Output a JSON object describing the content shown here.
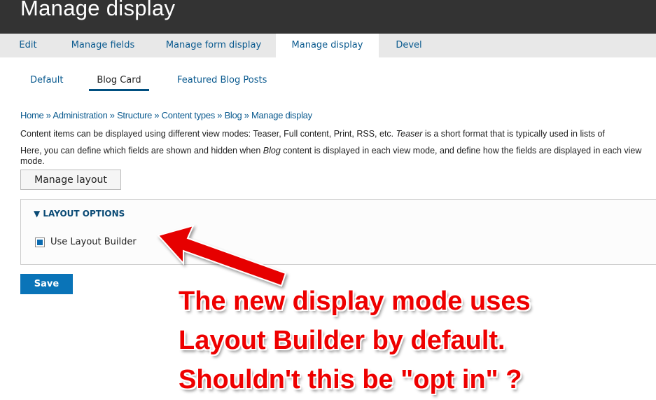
{
  "header": {
    "title": "Manage display"
  },
  "tabs": [
    {
      "label": "Edit"
    },
    {
      "label": "Manage fields"
    },
    {
      "label": "Manage form display"
    },
    {
      "label": "Manage display"
    },
    {
      "label": "Devel"
    }
  ],
  "subtabs": [
    {
      "label": "Default"
    },
    {
      "label": "Blog Card"
    },
    {
      "label": "Featured Blog Posts"
    }
  ],
  "breadcrumb": [
    "Home",
    "Administration",
    "Structure",
    "Content types",
    "Blog",
    "Manage display"
  ],
  "breadcrumb_sep": " » ",
  "intro1": {
    "a": "Content items can be displayed using different view modes: Teaser, Full content, Print, RSS, etc. ",
    "em": "Teaser",
    "b": " is a short format that is typically used in lists of"
  },
  "intro2": {
    "a": "Here, you can define which fields are shown and hidden when ",
    "em": "Blog",
    "b": " content is displayed in each view mode, and define how the fields are displayed in each view mode."
  },
  "manage_layout_label": "Manage layout",
  "layout_options": {
    "summary": "LAYOUT OPTIONS",
    "checkbox_label": "Use Layout Builder",
    "checked": true
  },
  "save_label": "Save",
  "annotation": [
    "The new display mode uses",
    "Layout Builder by default.",
    "Shouldn't this be \"opt in\" ?"
  ]
}
